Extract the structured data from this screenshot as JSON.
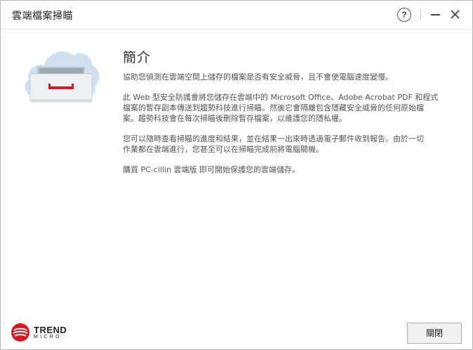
{
  "window": {
    "title": "雲端檔案掃瞄"
  },
  "titlebar": {
    "help_label": "?"
  },
  "content": {
    "heading": "簡介",
    "paragraphs": [
      [
        "協助您偵測在雲端空間上儲存的檔案是否有安全威脅，且不會使電腦速度變慢。"
      ],
      [
        "此 Web 型安全防護會將您儲存在雲端中的 Microsoft Office、Adobe Acrobat PDF 和程式",
        "檔案的暫存副本傳送到趨勢科技進行掃瞄。然後它會隔離包含隱藏安全威脅的任何原始檔",
        "案。趨勢科技會在每次掃瞄後刪除暫存檔案，以維護您的隱私權。"
      ],
      [
        "您可以隨時查看掃瞄的進度和結果，並在結果一出來時透過電子郵件收到報告。由於一切",
        "作業都在雲端進行，您甚至可以在掃瞄完成前將電腦關機。"
      ],
      [
        "購買 PC-cillin 雲端版 即可開始保護您的雲端儲存。"
      ]
    ]
  },
  "footer": {
    "brand_name": "TREND",
    "brand_sub": "MICRO",
    "close_label": "關閉"
  },
  "colors": {
    "brand_red": "#d71921",
    "cloud_blue": "#cfe0ee",
    "drawer_gray": "#e6e9ec"
  }
}
